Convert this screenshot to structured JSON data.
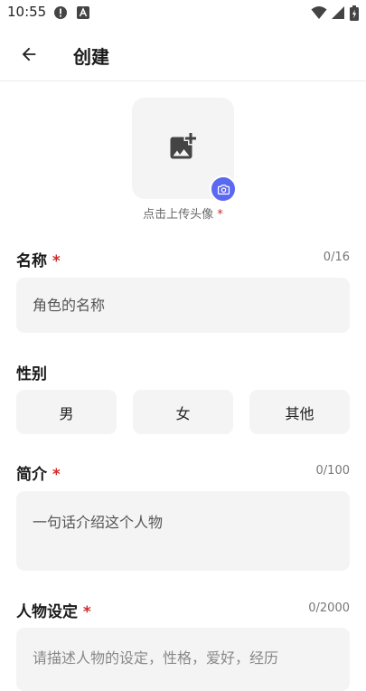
{
  "status_bar": {
    "time": "10:55",
    "icons": [
      "alert-icon",
      "a-icon",
      "wifi-icon",
      "signal-icon",
      "battery-icon"
    ]
  },
  "app_bar": {
    "title": "创建",
    "back_icon": "arrow-left-icon"
  },
  "avatar": {
    "caption": "点击上传头像",
    "required_mark": "*",
    "icon": "add-photo-icon",
    "badge_icon": "camera-icon",
    "badge_color": "#5b68f0"
  },
  "name": {
    "label": "名称",
    "required_mark": "*",
    "counter": "0/16",
    "placeholder": "角色的名称"
  },
  "gender": {
    "label": "性别",
    "options": [
      "男",
      "女",
      "其他"
    ]
  },
  "intro": {
    "label": "简介",
    "required_mark": "*",
    "counter": "0/100",
    "placeholder": "一句话介绍这个人物"
  },
  "persona": {
    "label": "人物设定",
    "required_mark": "*",
    "counter": "0/2000",
    "placeholder": "请描述人物的设定，性格，爱好，经历"
  },
  "colors": {
    "accent": "#5b68f0",
    "required": "#d02a2a",
    "field_bg": "#f4f4f4"
  }
}
